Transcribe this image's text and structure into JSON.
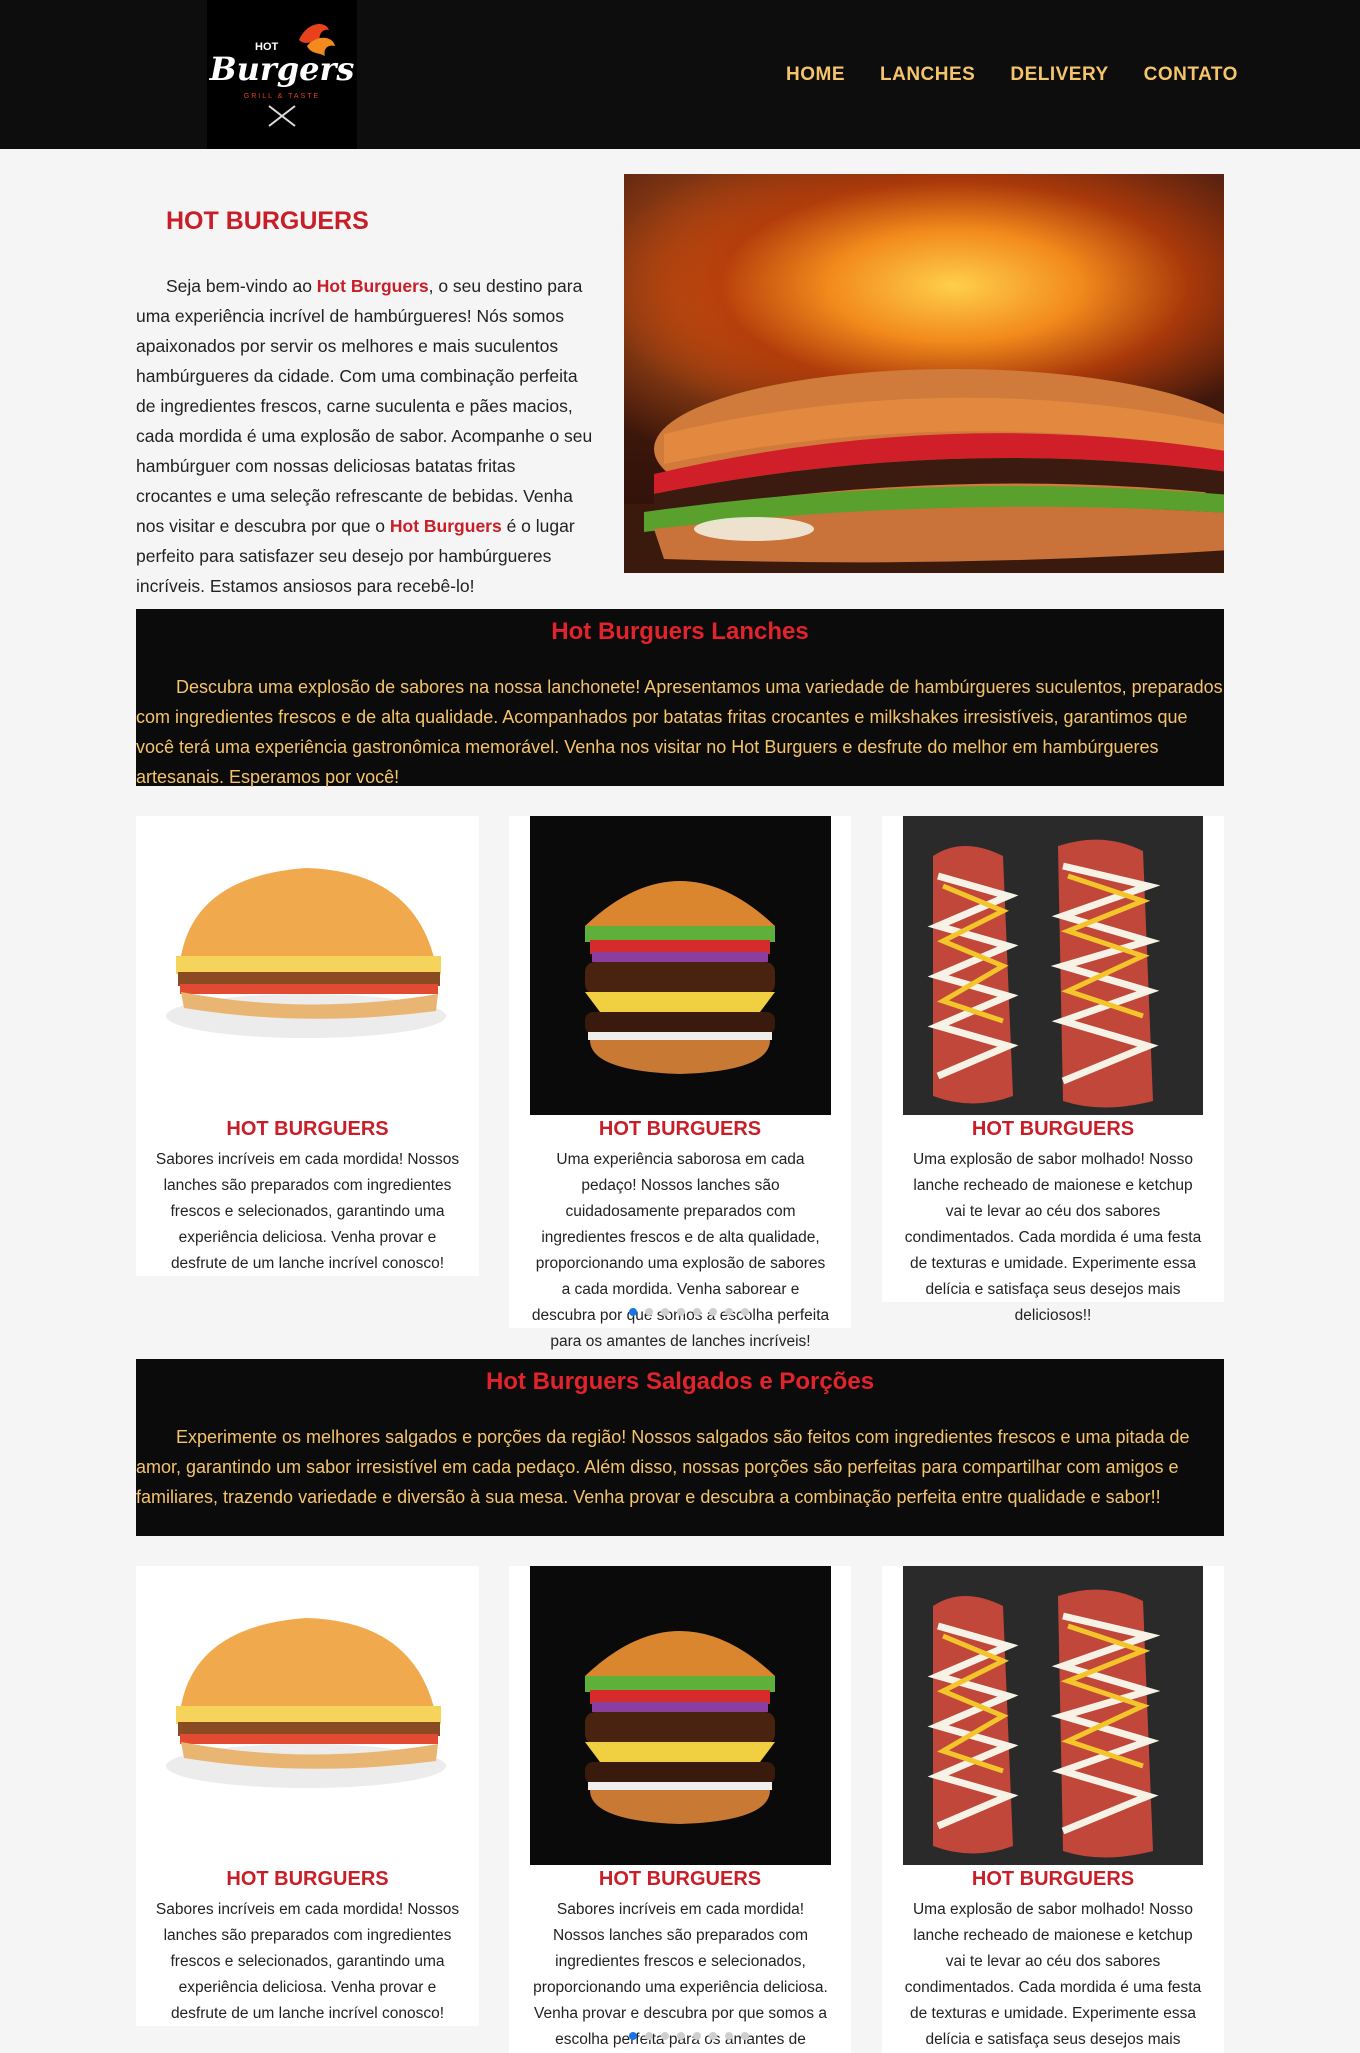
{
  "header": {
    "logo": {
      "line1": "HOT",
      "line2": "Burgers",
      "line3": "GRILL & TASTE"
    },
    "nav": [
      "HOME",
      "LANCHES",
      "DELIVERY",
      "CONTATO"
    ]
  },
  "intro": {
    "title": "HOT BURGUERS",
    "p1": "Seja bem-vindo ao ",
    "brand1": "Hot Burguers",
    "p2": ", o seu destino para uma experiência incrível de hambúrgueres! Nós somos apaixonados por servir os melhores e mais suculentos hambúrgueres da cidade. Com uma combinação perfeita de ingredientes frescos, carne suculenta e pães macios, cada mordida é uma explosão de sabor. Acompanhe o seu hambúrguer com nossas deliciosas batatas fritas crocantes e uma seleção refrescante de bebidas. Venha nos visitar e descubra por que o ",
    "brand2": "Hot Burguers",
    "p3": " é o lugar perfeito para satisfazer seu desejo por hambúrgueres incríveis. Estamos ansiosos para recebê-lo!"
  },
  "lanches": {
    "title": "Hot Burguers Lanches",
    "text": "Descubra uma explosão de sabores na nossa lanchonete! Apresentamos uma variedade de hambúrgueres suculentos, preparados com ingredientes frescos e de alta qualidade. Acompanhados por batatas fritas crocantes e milkshakes irresistíveis, garantimos que você terá uma experiência gastronômica memorável. Venha nos visitar no Hot Burguers e desfrute do melhor em hambúrgueres artesanais. Esperamos por você!",
    "cards": [
      {
        "title": "HOT BURGUERS",
        "text": "Sabores incríveis em cada mordida! Nossos lanches são preparados com ingredientes frescos e selecionados, garantindo uma experiência deliciosa. Venha provar e desfrute de um lanche incrível conosco!"
      },
      {
        "title": "HOT BURGUERS",
        "text": "Uma experiência saborosa em cada pedaço! Nossos lanches são cuidadosamente preparados com ingredientes frescos e de alta qualidade, proporcionando uma explosão de sabores a cada mordida. Venha saborear e descubra por que somos a escolha perfeita para os amantes de lanches incríveis!"
      },
      {
        "title": "HOT BURGUERS",
        "text": "Uma explosão de sabor molhado! Nosso lanche recheado de maionese e ketchup vai te levar ao céu dos sabores condimentados. Cada mordida é uma festa de texturas e umidade. Experimente essa delícia e satisfaça seus desejos mais deliciosos!!"
      }
    ]
  },
  "salgados": {
    "title": "Hot Burguers Salgados e Porções",
    "text": "Experimente os melhores salgados e porções da região! Nossos salgados são feitos com ingredientes frescos e uma pitada de amor, garantindo um sabor irresistível em cada pedaço. Além disso, nossas porções são perfeitas para compartilhar com amigos e familiares, trazendo variedade e diversão à sua mesa. Venha provar e descubra a combinação perfeita entre qualidade e sabor!!",
    "cards": [
      {
        "title": "HOT BURGUERS",
        "text": "Sabores incríveis em cada mordida! Nossos lanches são preparados com ingredientes frescos e selecionados, garantindo uma experiência deliciosa. Venha provar e desfrute de um lanche incrível conosco!"
      },
      {
        "title": "HOT BURGUERS",
        "text": "Sabores incríveis em cada mordida! Nossos lanches são preparados com ingredientes frescos e selecionados, proporcionando uma experiência deliciosa. Venha provar e descubra por que somos a escolha perfeita para os amantes de lanches incríveis!"
      },
      {
        "title": "HOT BURGUERS",
        "text": "Uma explosão de sabor molhado! Nosso lanche recheado de maionese e ketchup vai te levar ao céu dos sabores condimentados. Cada mordida é uma festa de texturas e umidade. Experimente essa delícia e satisfaça seus desejos mais deliciosos!!"
      }
    ]
  },
  "colors": {
    "accent": "#c81e28",
    "nav": "#f5c46a",
    "band": "#0b0b0b"
  }
}
